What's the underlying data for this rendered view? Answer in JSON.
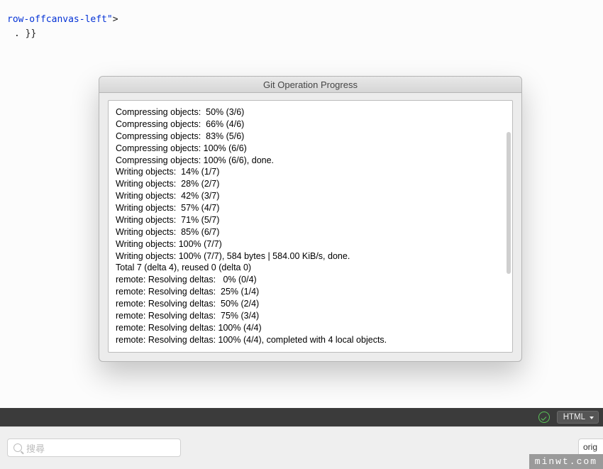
{
  "code": {
    "line1_text": "row-offcanvas-left\"",
    "line1_end": ">",
    "line2": ". }}"
  },
  "dialog": {
    "title": "Git Operation Progress",
    "log_lines": [
      "Compressing objects:  50% (3/6)",
      "Compressing objects:  66% (4/6)",
      "Compressing objects:  83% (5/6)",
      "Compressing objects: 100% (6/6)",
      "Compressing objects: 100% (6/6), done.",
      "Writing objects:  14% (1/7)",
      "Writing objects:  28% (2/7)",
      "Writing objects:  42% (3/7)",
      "Writing objects:  57% (4/7)",
      "Writing objects:  71% (5/7)",
      "Writing objects:  85% (6/7)",
      "Writing objects: 100% (7/7)",
      "Writing objects: 100% (7/7), 584 bytes | 584.00 KiB/s, done.",
      "Total 7 (delta 4), reused 0 (delta 0)",
      "remote: Resolving deltas:   0% (0/4)",
      "remote: Resolving deltas:  25% (1/4)",
      "remote: Resolving deltas:  50% (2/4)",
      "remote: Resolving deltas:  75% (3/4)",
      "remote: Resolving deltas: 100% (4/4)",
      "remote: Resolving deltas: 100% (4/4), completed with 4 local objects."
    ]
  },
  "status_bar": {
    "language": "HTML"
  },
  "bottom": {
    "search_placeholder": "搜尋",
    "right_field": "orig"
  },
  "watermark": "minwt.com"
}
